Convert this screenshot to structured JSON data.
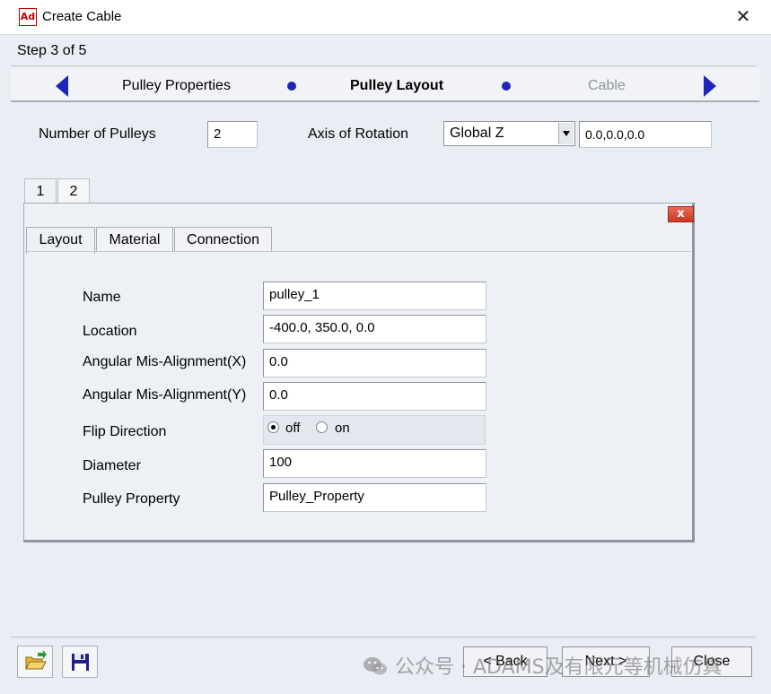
{
  "window": {
    "title": "Create Cable",
    "app_icon": "Ad",
    "close_glyph": "✕"
  },
  "step": {
    "label": "Step 3 of 5"
  },
  "nav": {
    "steps": [
      {
        "label": "Pulley Properties",
        "state": "done"
      },
      {
        "label": "Pulley Layout",
        "state": "current"
      },
      {
        "label": "Cable",
        "state": "future"
      }
    ],
    "accent": "#1d26b8"
  },
  "top_fields": {
    "num_pulleys_label": "Number of Pulleys",
    "num_pulleys_value": "2",
    "axis_label": "Axis of Rotation",
    "axis_selected": "Global Z",
    "axis_vector": "0.0,0.0,0.0"
  },
  "pulley_tabs": [
    "1",
    "2"
  ],
  "panel_close_glyph": "x",
  "sub_tabs": [
    "Layout",
    "Material",
    "Connection"
  ],
  "layout": {
    "name_label": "Name",
    "name_value": "pulley_1",
    "location_label": "Location",
    "location_value": "-400.0, 350.0, 0.0",
    "angx_label": "Angular Mis-Alignment(X)",
    "angx_value": "0.0",
    "angy_label": "Angular Mis-Alignment(Y)",
    "angy_value": "0.0",
    "flip_label": "Flip Direction",
    "flip_off": "off",
    "flip_on": "on",
    "flip_selected": "off",
    "diameter_label": "Diameter",
    "diameter_value": "100",
    "property_label": "Pulley Property",
    "property_value": "Pulley_Property"
  },
  "buttons": {
    "back": "< Back",
    "next": "Next >",
    "close": "Close"
  },
  "watermark": "公众号 · ADAMS及有限元等机械仿真"
}
